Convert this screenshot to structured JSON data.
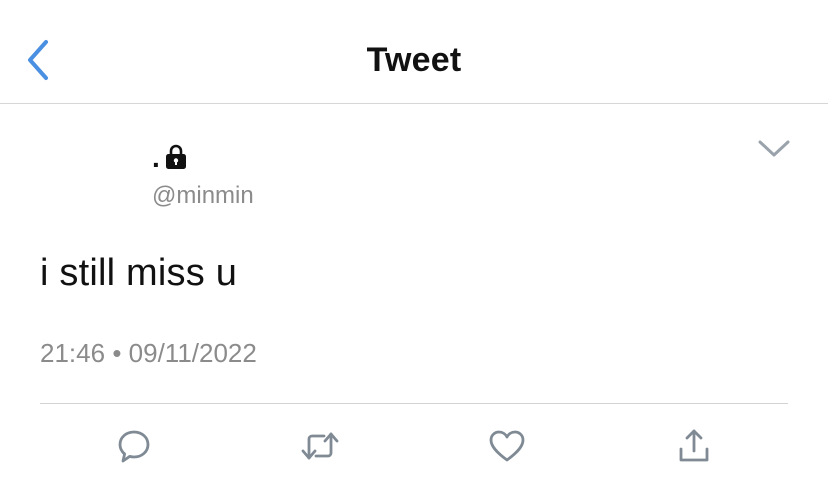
{
  "header": {
    "title": "Tweet"
  },
  "tweet": {
    "author_name": ".",
    "handle": "@minmin",
    "text": "i still miss u",
    "time": "21:46",
    "separator": "•",
    "date": "09/11/2022"
  },
  "icons": {
    "back": "chevron-left-icon",
    "lock": "lock-icon",
    "caret": "chevron-down-icon",
    "reply": "reply-icon",
    "retweet": "retweet-icon",
    "like": "heart-icon",
    "share": "share-icon"
  },
  "colors": {
    "accent": "#4a90e2",
    "icon_gray": "#7f8a94",
    "text": "#111111",
    "secondary_text": "#8b8b8b",
    "divider": "#d3d3d3"
  }
}
